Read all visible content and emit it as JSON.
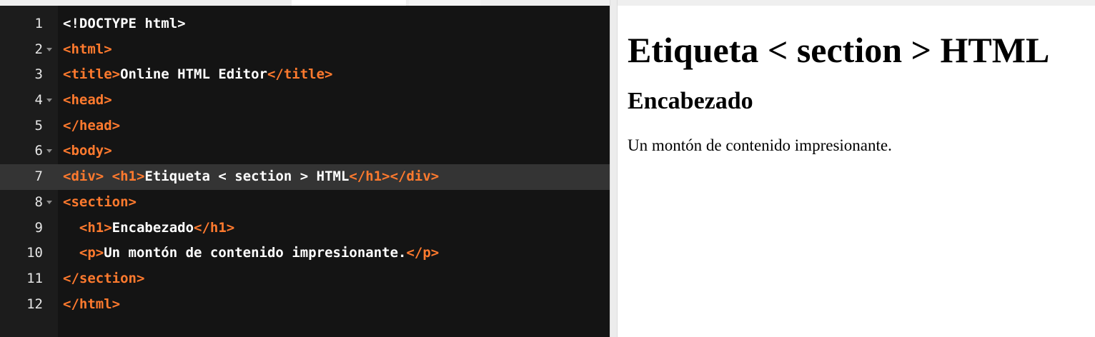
{
  "colors": {
    "editor_bg": "#141414",
    "gutter_bg": "#1c1c1c",
    "active_line_bg": "#343434",
    "tag_color": "#ff7a2e",
    "text_color": "#ffffff",
    "preview_bg": "#ffffff"
  },
  "editor": {
    "lines": [
      {
        "num": "1",
        "fold": false,
        "active": false,
        "segments": [
          {
            "t": "txt",
            "v": "<!DOCTYPE html>"
          }
        ]
      },
      {
        "num": "2",
        "fold": true,
        "active": false,
        "segments": [
          {
            "t": "tag",
            "v": "<html>"
          }
        ]
      },
      {
        "num": "3",
        "fold": false,
        "active": false,
        "segments": [
          {
            "t": "tag",
            "v": "<title>"
          },
          {
            "t": "txt",
            "v": "Online HTML Editor"
          },
          {
            "t": "tag",
            "v": "</title>"
          }
        ]
      },
      {
        "num": "4",
        "fold": true,
        "active": false,
        "segments": [
          {
            "t": "tag",
            "v": "<head>"
          }
        ]
      },
      {
        "num": "5",
        "fold": false,
        "active": false,
        "segments": [
          {
            "t": "tag",
            "v": "</head>"
          }
        ]
      },
      {
        "num": "6",
        "fold": true,
        "active": false,
        "segments": [
          {
            "t": "tag",
            "v": "<body>"
          }
        ]
      },
      {
        "num": "7",
        "fold": false,
        "active": true,
        "segments": [
          {
            "t": "tag",
            "v": "<div>"
          },
          {
            "t": "txt",
            "v": " "
          },
          {
            "t": "tag",
            "v": "<h1>"
          },
          {
            "t": "txt",
            "v": "Etiqueta < section > HTML"
          },
          {
            "t": "tag",
            "v": "</h1></div>"
          }
        ]
      },
      {
        "num": "8",
        "fold": true,
        "active": false,
        "segments": [
          {
            "t": "tag",
            "v": "<section>"
          }
        ]
      },
      {
        "num": "9",
        "fold": false,
        "active": false,
        "segments": [
          {
            "t": "txt",
            "v": "  "
          },
          {
            "t": "tag",
            "v": "<h1>"
          },
          {
            "t": "txt",
            "v": "Encabezado"
          },
          {
            "t": "tag",
            "v": "</h1>"
          }
        ]
      },
      {
        "num": "10",
        "fold": false,
        "active": false,
        "segments": [
          {
            "t": "txt",
            "v": "  "
          },
          {
            "t": "tag",
            "v": "<p>"
          },
          {
            "t": "txt",
            "v": "Un montón de contenido impresionante."
          },
          {
            "t": "tag",
            "v": "</p>"
          }
        ]
      },
      {
        "num": "11",
        "fold": false,
        "active": false,
        "segments": [
          {
            "t": "tag",
            "v": "</section>"
          }
        ]
      },
      {
        "num": "12",
        "fold": false,
        "active": false,
        "segments": [
          {
            "t": "tag",
            "v": "</html>"
          }
        ]
      }
    ]
  },
  "preview": {
    "heading": "Etiqueta < section > HTML",
    "subheading": "Encabezado",
    "paragraph": "Un montón de contenido impresionante."
  }
}
